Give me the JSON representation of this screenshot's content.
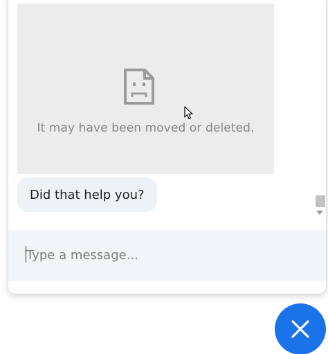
{
  "chat": {
    "broken_image": {
      "icon": "broken-page-icon",
      "message": "It may have been moved or deleted."
    },
    "bot_message": "Did that help you?",
    "composer": {
      "placeholder": "Type a message...",
      "value": ""
    },
    "close_button": {
      "icon": "close-icon"
    }
  },
  "colors": {
    "accent": "#1a73e8",
    "bubble_bg": "#edf2f7",
    "composer_bg": "#f3f6f9",
    "broken_image_bg": "#ececec"
  }
}
